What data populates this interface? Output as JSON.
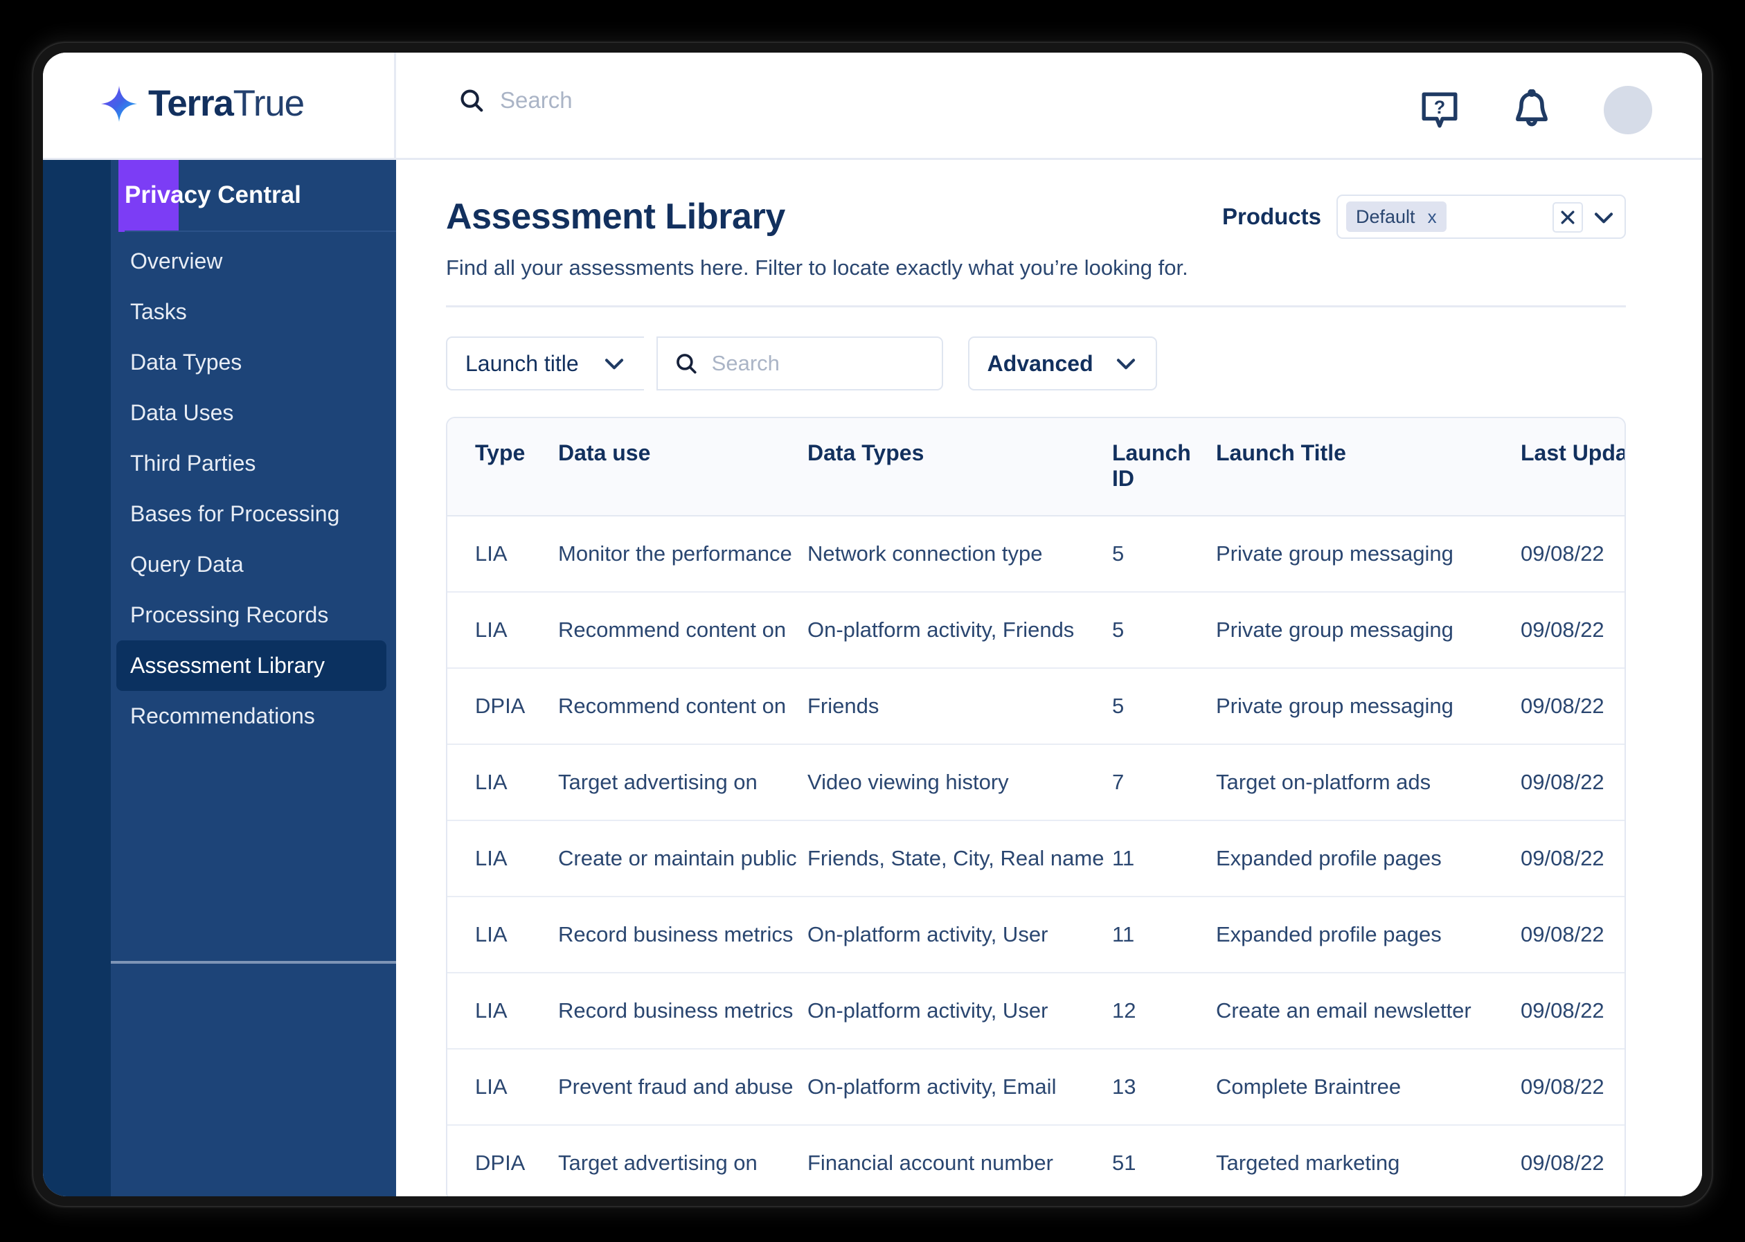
{
  "brand": {
    "logo_text_bold": "Terra",
    "logo_text_light": "True",
    "logo_icon": "four-point-star-icon",
    "accent_purple": "#7c3df5",
    "navy": "#12305e",
    "sidebar_dark": "#0d3461",
    "sidebar_light": "#1d4478"
  },
  "topbar": {
    "search_placeholder": "Search",
    "search_icon": "search-icon",
    "help_icon": "help-bubble-icon",
    "help_glyph": "?",
    "notifications_icon": "bell-icon",
    "avatar_icon": "avatar"
  },
  "sidebar": {
    "title": "Privacy Central",
    "items": [
      {
        "label": "Overview",
        "active": false
      },
      {
        "label": "Tasks",
        "active": false
      },
      {
        "label": "Data Types",
        "active": false
      },
      {
        "label": "Data Uses",
        "active": false
      },
      {
        "label": "Third Parties",
        "active": false
      },
      {
        "label": "Bases for Processing",
        "active": false
      },
      {
        "label": "Query Data",
        "active": false
      },
      {
        "label": "Processing Records",
        "active": false
      },
      {
        "label": "Assessment Library",
        "active": true
      },
      {
        "label": "Recommendations",
        "active": false
      }
    ]
  },
  "page": {
    "title": "Assessment Library",
    "subtitle": "Find all your assessments here. Filter to locate exactly what you’re looking for."
  },
  "products_filter": {
    "label": "Products",
    "chips": [
      {
        "label": "Default",
        "remove_glyph": "x"
      }
    ],
    "clear_glyph": "×",
    "caret_icon": "chevron-down-icon"
  },
  "filters": {
    "field_select_value": "Launch title",
    "field_select_caret": "chevron-down-icon",
    "search_placeholder": "Search",
    "search_icon": "search-icon",
    "advanced_label": "Advanced",
    "advanced_caret": "chevron-down-icon"
  },
  "table": {
    "columns": [
      "Type",
      "Data use",
      "Data Types",
      "Launch ID",
      "Launch Title",
      "Last Updated"
    ],
    "rows": [
      {
        "type": "LIA",
        "data_use": "Monitor the performance",
        "data_types": "Network connection type",
        "launch_id": "5",
        "launch_title": "Private group messaging",
        "last_updated": "09/08/22"
      },
      {
        "type": "LIA",
        "data_use": "Recommend content on",
        "data_types": "On-platform activity, Friends",
        "launch_id": "5",
        "launch_title": "Private group messaging",
        "last_updated": "09/08/22"
      },
      {
        "type": "DPIA",
        "data_use": "Recommend content on",
        "data_types": "Friends",
        "launch_id": "5",
        "launch_title": "Private group messaging",
        "last_updated": "09/08/22"
      },
      {
        "type": "LIA",
        "data_use": "Target advertising on",
        "data_types": "Video viewing history",
        "launch_id": "7",
        "launch_title": "Target on-platform ads",
        "last_updated": "09/08/22"
      },
      {
        "type": "LIA",
        "data_use": "Create or maintain public",
        "data_types": "Friends, State, City, Real name",
        "launch_id": "11",
        "launch_title": "Expanded profile pages",
        "last_updated": "09/08/22"
      },
      {
        "type": "LIA",
        "data_use": "Record business metrics",
        "data_types": "On-platform activity, User",
        "launch_id": "11",
        "launch_title": "Expanded profile pages",
        "last_updated": "09/08/22"
      },
      {
        "type": "LIA",
        "data_use": "Record business metrics",
        "data_types": "On-platform activity, User",
        "launch_id": "12",
        "launch_title": "Create an email newsletter",
        "last_updated": "09/08/22"
      },
      {
        "type": "LIA",
        "data_use": "Prevent fraud and abuse",
        "data_types": "On-platform activity, Email",
        "launch_id": "13",
        "launch_title": "Complete Braintree",
        "last_updated": "09/08/22"
      },
      {
        "type": "DPIA",
        "data_use": "Target advertising on",
        "data_types": "Financial account number",
        "launch_id": "51",
        "launch_title": "Targeted marketing",
        "last_updated": "09/08/22"
      }
    ]
  }
}
